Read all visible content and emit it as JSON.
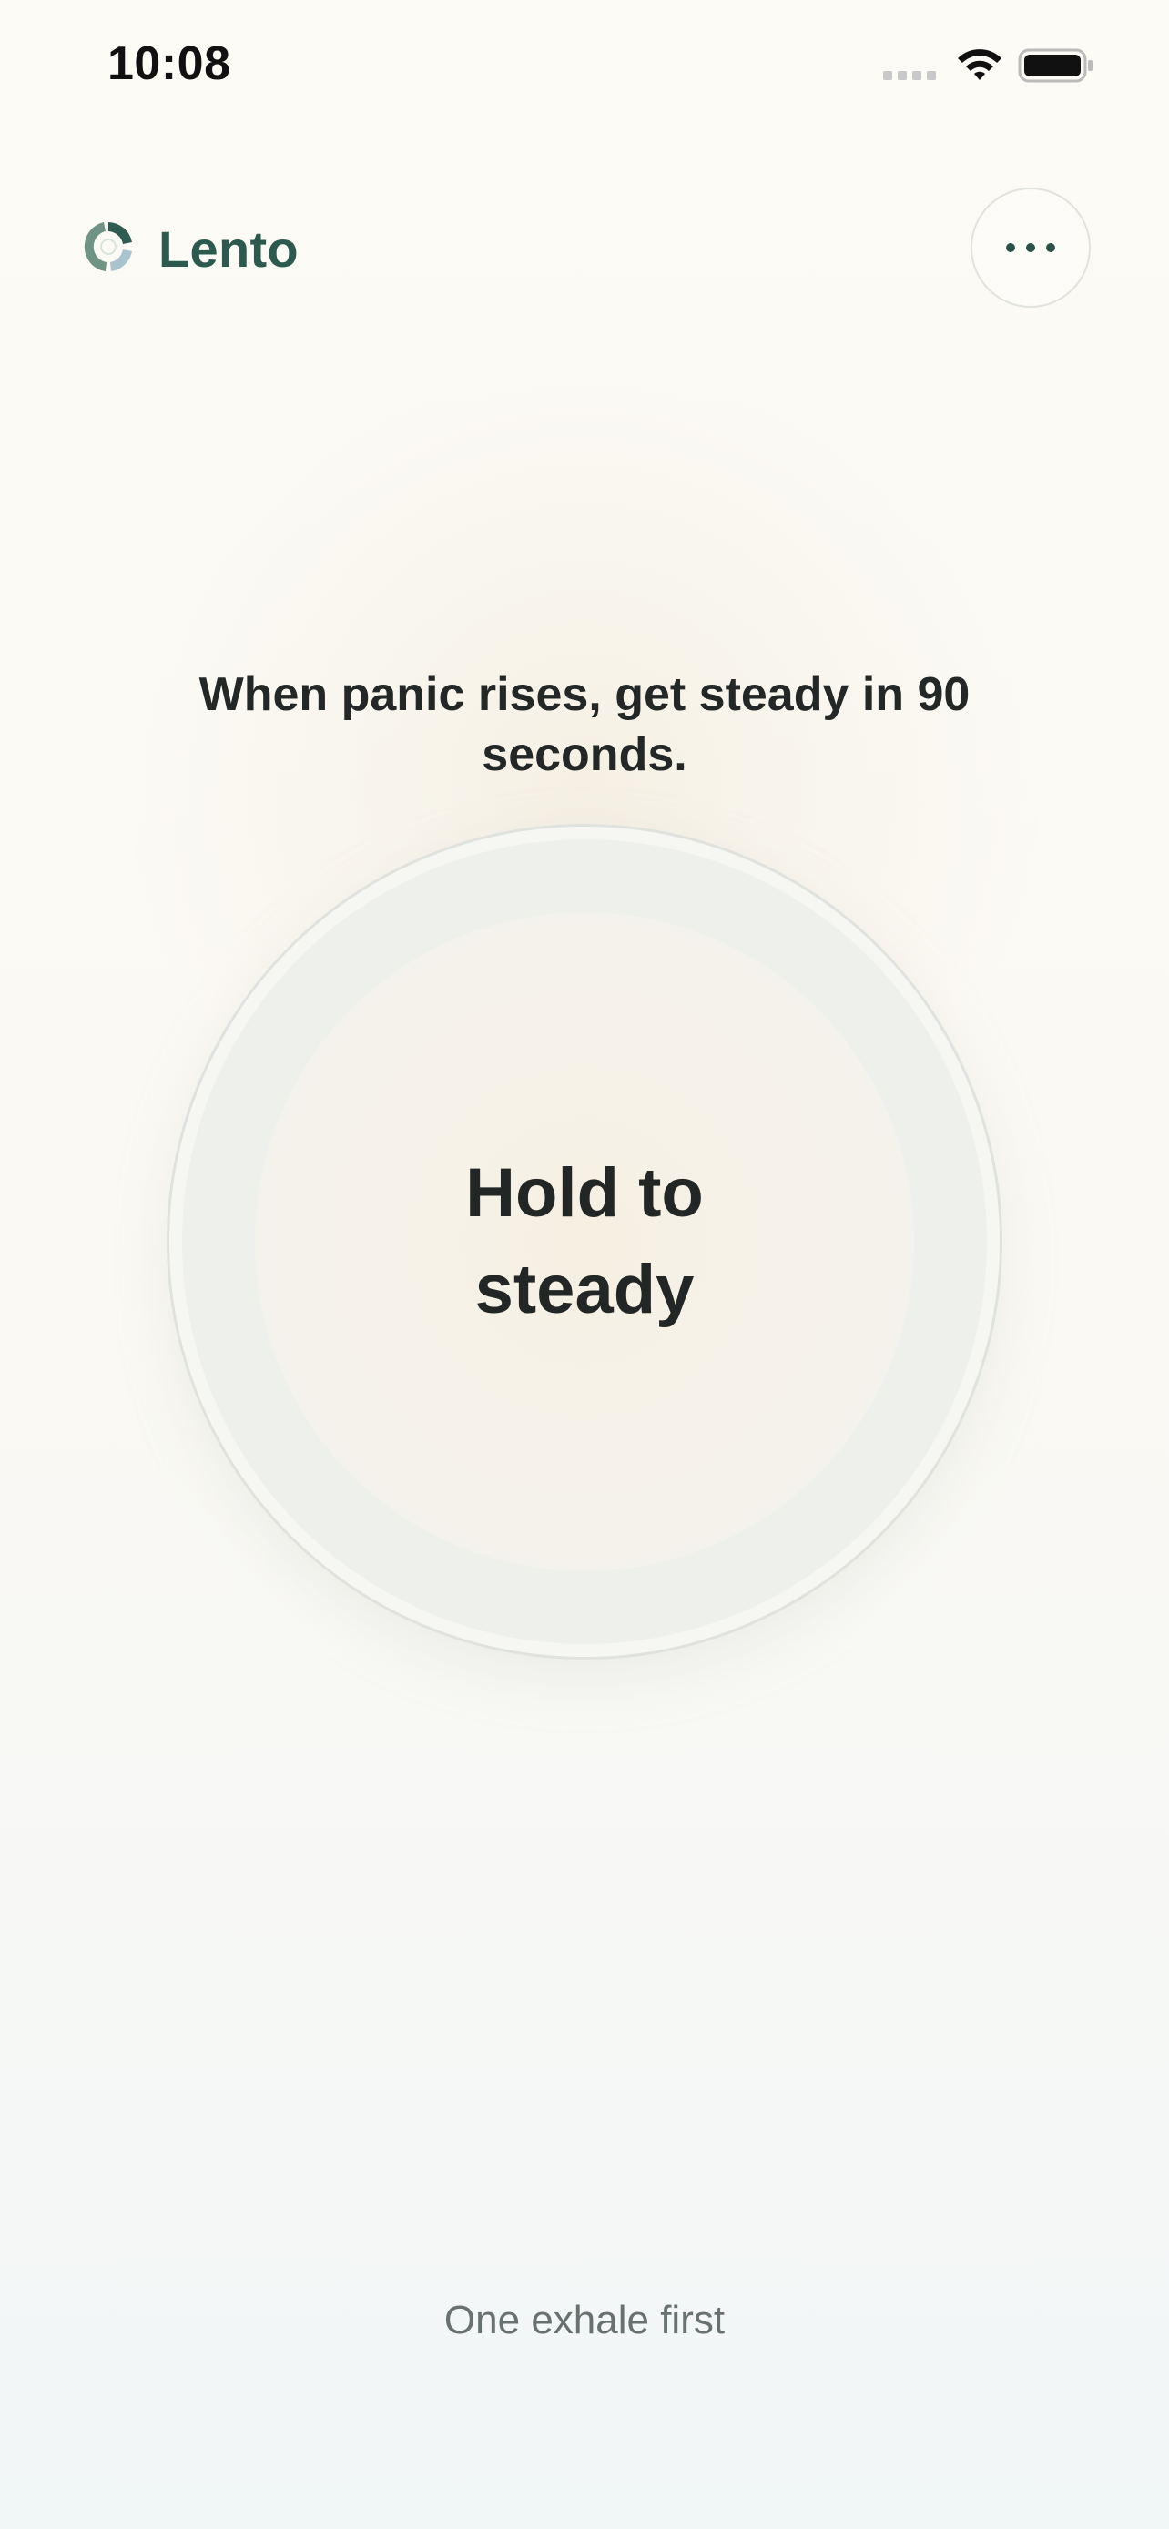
{
  "status_bar": {
    "time": "10:08",
    "icons": [
      "cellular-signal-icon",
      "wifi-icon",
      "battery-icon"
    ]
  },
  "header": {
    "app_name": "Lento",
    "logo_icon": "lento-logo-icon",
    "menu_icon": "ellipsis-icon"
  },
  "main": {
    "tagline": "When panic rises, get steady in 90 seconds.",
    "hold_button_label": "Hold to steady"
  },
  "footer": {
    "hint": "One exhale first"
  },
  "colors": {
    "brand": "#2c5a4f",
    "text": "#232826",
    "muted": "#67716e",
    "background": "#fbf9f3"
  }
}
